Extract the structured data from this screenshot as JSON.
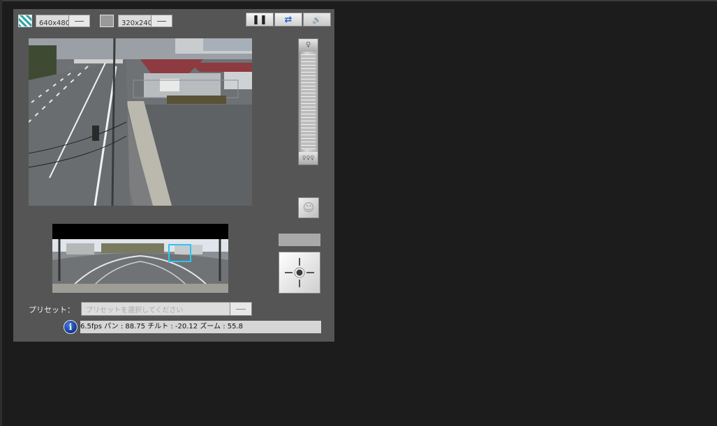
{
  "toolbar": {
    "resolution_large": "640x480",
    "resolution_small": "320x240",
    "pause_symbol": "❚❚",
    "swap_symbol": "⇄",
    "audio_symbol": "🔊"
  },
  "icons": {
    "resolution_large": "checker-pattern-icon",
    "resolution_small": "gray-square-icon",
    "pause": "pause-icon",
    "swap": "swap-arrows-icon",
    "audio": "speaker-icon",
    "zoom_in": "zoom-in-icon",
    "zoom_out": "zoom-out-icon",
    "focus": "auto-focus-icon",
    "ptz": "crosshair-icon",
    "info": "info-icon"
  },
  "zoom": {
    "top_symbol": "♀",
    "bottom_symbol": "♀♀♀"
  },
  "focus_symbol": "☺",
  "preset": {
    "label": "プリセット：",
    "placeholder": "プリセットを選択してください"
  },
  "info_symbol": "i",
  "status": {
    "text": "6.5fps パン : 88.75 チルト : -20.12 ズーム : 55.8"
  },
  "colors": {
    "page_background": "#1c1c1c",
    "panel_background": "#555555",
    "panorama_selection": "#2fc4f2",
    "swap_icon": "#1f66c4"
  }
}
